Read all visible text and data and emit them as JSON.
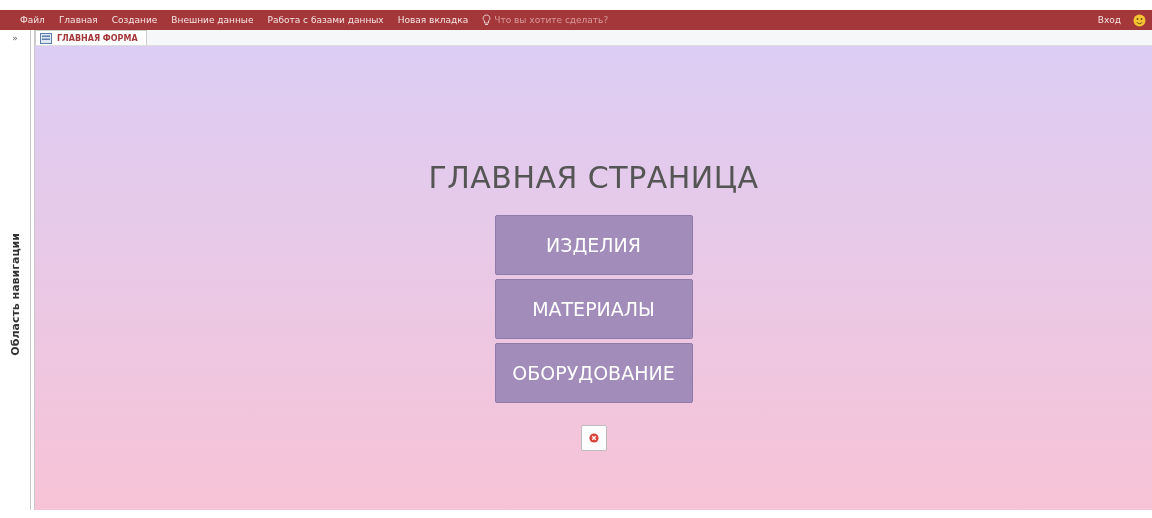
{
  "menu": [
    {
      "label": "Файл"
    },
    {
      "label": "Главная"
    },
    {
      "label": "Создание"
    },
    {
      "label": "Внешние данные"
    },
    {
      "label": "Работа с базами данных"
    },
    {
      "label": "Новая вкладка"
    }
  ],
  "tell_me": {
    "placeholder": "Что вы хотите сделать?"
  },
  "sign_in": "Вход",
  "nav_pane": {
    "toggle": "»",
    "title": "Область навигации"
  },
  "tabs": [
    {
      "label": "ГЛАВНАЯ ФОРМА",
      "selected": true
    }
  ],
  "form": {
    "title": "ГЛАВНАЯ СТРАНИЦА",
    "buttons": [
      "ИЗДЕЛИЯ",
      "МАТЕРИАЛЫ",
      "ОБОРУДОВАНИЕ"
    ]
  }
}
